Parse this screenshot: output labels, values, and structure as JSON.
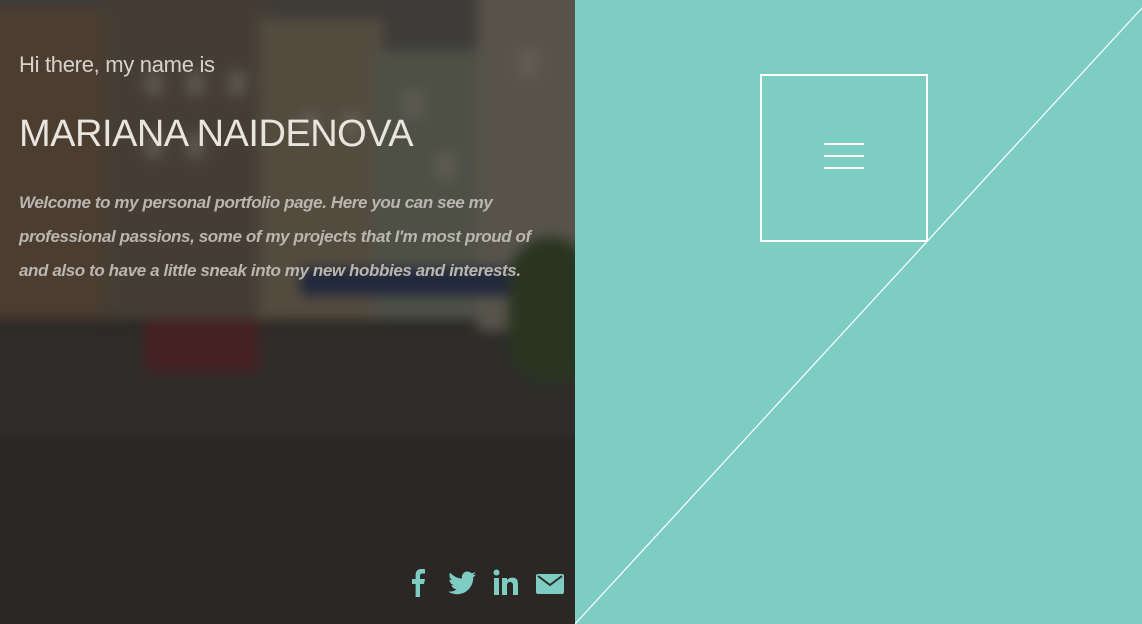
{
  "hero": {
    "greeting": "Hi there, my name is",
    "name": "MARIANA NAIDENOVA",
    "welcome": "Welcome to my personal portfolio page. Here you can see my professional passions, some of my projects that I'm most proud of and also to have a little sneak into my new hobbies and interests."
  },
  "social": {
    "icons": [
      "facebook-icon",
      "twitter-icon",
      "linkedin-icon",
      "mail-icon"
    ],
    "color": "#7dcdc2"
  },
  "aside": {
    "background": "#7dcdc2",
    "menu_icon": "hamburger-icon"
  }
}
